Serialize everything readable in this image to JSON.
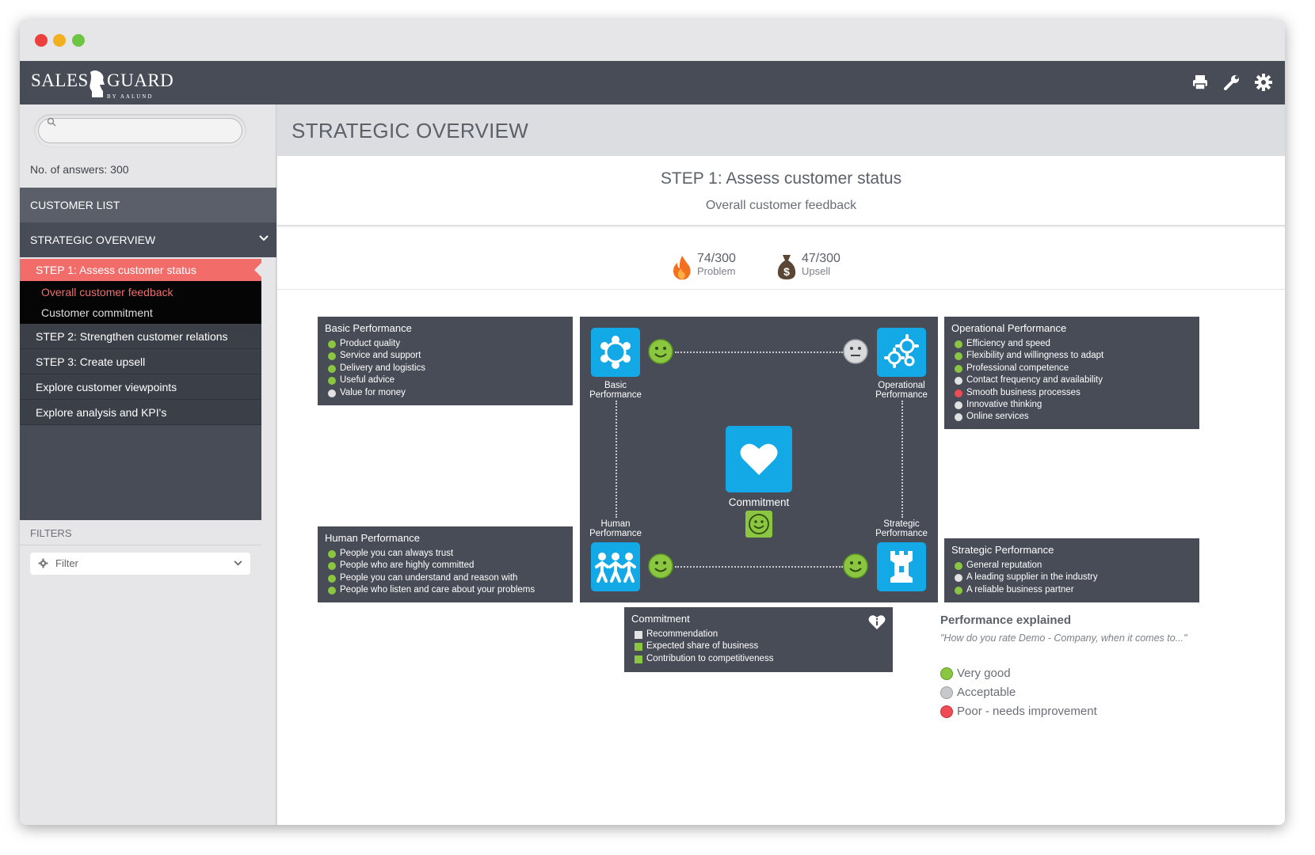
{
  "app": {
    "logo_left": "SALES",
    "logo_right": "GUARD",
    "logo_sub": "BY AALUND"
  },
  "sidebar": {
    "search_placeholder": "",
    "answers": "No. of answers: 300",
    "customer_list": "CUSTOMER LIST",
    "strategic_overview": "STRATEGIC OVERVIEW",
    "active_step": "STEP 1: Assess customer status",
    "substeps": [
      "Overall customer feedback",
      "Customer commitment"
    ],
    "steps": [
      "STEP 2: Strengthen customer relations",
      "STEP 3: Create upsell",
      "Explore customer viewpoints",
      "Explore analysis and KPI's"
    ],
    "filters_label": "FILTERS",
    "filter_value": "Filter"
  },
  "main": {
    "page_title": "STRATEGIC OVERVIEW",
    "step_title": "STEP 1: Assess customer status",
    "step_subtitle": "Overall customer feedback",
    "problem_value": "74/300",
    "problem_label": "Problem",
    "upsell_value": "47/300",
    "upsell_label": "Upsell"
  },
  "panels": {
    "basic": {
      "title": "Basic Performance",
      "items": [
        {
          "text": "Product quality",
          "status": "good"
        },
        {
          "text": "Service and support",
          "status": "good"
        },
        {
          "text": "Delivery and logistics",
          "status": "good"
        },
        {
          "text": "Useful advice",
          "status": "good"
        },
        {
          "text": "Value for money",
          "status": "acceptable"
        }
      ]
    },
    "operational": {
      "title": "Operational Performance",
      "items": [
        {
          "text": "Efficiency and speed",
          "status": "good"
        },
        {
          "text": "Flexibility and willingness to adapt",
          "status": "good"
        },
        {
          "text": "Professional competence",
          "status": "good"
        },
        {
          "text": "Contact frequency and availability",
          "status": "acceptable"
        },
        {
          "text": "Smooth business processes",
          "status": "poor"
        },
        {
          "text": "Innovative thinking",
          "status": "acceptable"
        },
        {
          "text": "Online services",
          "status": "acceptable"
        }
      ]
    },
    "human": {
      "title": "Human Performance",
      "items": [
        {
          "text": "People you can always trust",
          "status": "good"
        },
        {
          "text": "People who are highly committed",
          "status": "good"
        },
        {
          "text": "People you can understand and reason with",
          "status": "good"
        },
        {
          "text": "People who listen and care about your problems",
          "status": "good"
        }
      ]
    },
    "strategic": {
      "title": "Strategic Performance",
      "items": [
        {
          "text": "General reputation",
          "status": "good"
        },
        {
          "text": "A leading supplier in the industry",
          "status": "acceptable"
        },
        {
          "text": "A reliable business partner",
          "status": "good"
        }
      ]
    },
    "commitment": {
      "title": "Commitment",
      "items": [
        {
          "text": "Recommendation",
          "status": "acceptable"
        },
        {
          "text": "Expected share of business",
          "status": "good"
        },
        {
          "text": "Contribution to competitiveness",
          "status": "good"
        }
      ]
    }
  },
  "diagram": {
    "basic_label_1": "Basic",
    "basic_label_2": "Performance",
    "operational_label_1": "Operational",
    "operational_label_2": "Performance",
    "human_label_1": "Human",
    "human_label_2": "Performance",
    "strategic_label_1": "Strategic",
    "strategic_label_2": "Performance",
    "commitment_label": "Commitment",
    "basic_status": "good",
    "operational_status": "acceptable",
    "human_status": "good",
    "strategic_status": "good",
    "commitment_status": "good"
  },
  "legend": {
    "title": "Performance explained",
    "quote": "\"How do you rate Demo - Company, when it comes to...\"",
    "items": [
      {
        "text": "Very good",
        "color": "#8ac640"
      },
      {
        "text": "Acceptable",
        "color": "#c7c8cb"
      },
      {
        "text": "Poor - needs improvement",
        "color": "#ee4b54"
      }
    ]
  },
  "colors": {
    "accent": "#f26c6a",
    "tile": "#13a9e6",
    "good": "#8ac640",
    "acceptable": "#e2e2e2",
    "poor": "#ee4b54",
    "dark_panel": "#474c56"
  }
}
